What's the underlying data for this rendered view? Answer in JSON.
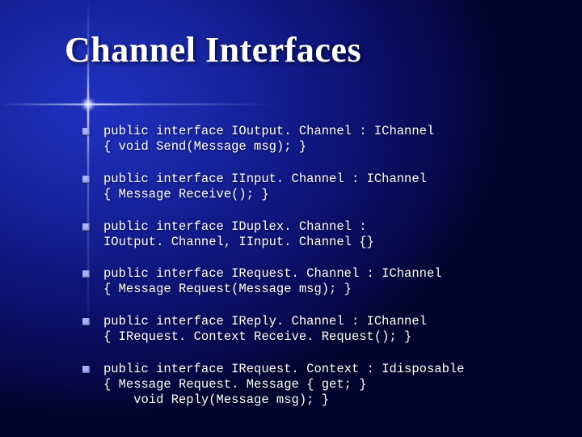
{
  "slide": {
    "title": "Channel Interfaces",
    "bullets": [
      {
        "line1": "public interface IOutput. Channel : IChannel",
        "line2": "{ void Send(Message msg); }"
      },
      {
        "line1": "public interface IInput. Channel : IChannel",
        "line2": "{ Message Receive(); }"
      },
      {
        "line1": "public interface IDuplex. Channel :",
        "line2": "IOutput. Channel, IInput. Channel {}"
      },
      {
        "line1": "public interface IRequest. Channel : IChannel",
        "line2": "{ Message Request(Message msg); }"
      },
      {
        "line1": "public interface IReply. Channel : IChannel",
        "line2": "{ IRequest. Context Receive. Request(); }"
      },
      {
        "line1": "public interface IRequest. Context : Idisposable",
        "line2": "{ Message Request. Message { get; }",
        "line3": "  void Reply(Message msg); }"
      }
    ]
  }
}
